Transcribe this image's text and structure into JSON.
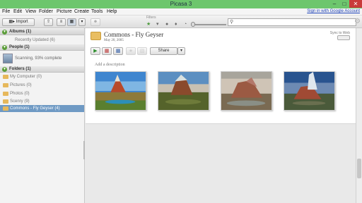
{
  "window": {
    "title": "Picasa 3"
  },
  "menu": {
    "items": [
      "File",
      "Edit",
      "View",
      "Folder",
      "Picture",
      "Create",
      "Tools",
      "Help"
    ],
    "signin": "Sign in with Google Account"
  },
  "toolbar": {
    "import_label": "Import",
    "filters_label": "Filters",
    "search_placeholder": ""
  },
  "sidebar": {
    "albums": {
      "header": "Albums (1)",
      "items": [
        "Recently Updated (6)"
      ]
    },
    "people": {
      "header": "People (1)",
      "scan_status": "Scanning, 93% complete"
    },
    "folders": {
      "header": "Folders (1)",
      "items": [
        "My Computer (0)",
        "Pictures (0)",
        "Photos (0)",
        "Scenry (9)"
      ],
      "selected": "Commons - Fly Geyser (4)"
    }
  },
  "album": {
    "title": "Commons - Fly Geyser",
    "date": "May 20, 2005",
    "sync_label": "Sync to Web",
    "share_label": "Share",
    "description_placeholder": "Add a description",
    "photo_count": 4
  },
  "colors": {
    "titlebar": "#6dc66d",
    "selection": "#6f9ac4",
    "collapse_icon": "#5c9e3a",
    "link": "#1a3fb5"
  }
}
